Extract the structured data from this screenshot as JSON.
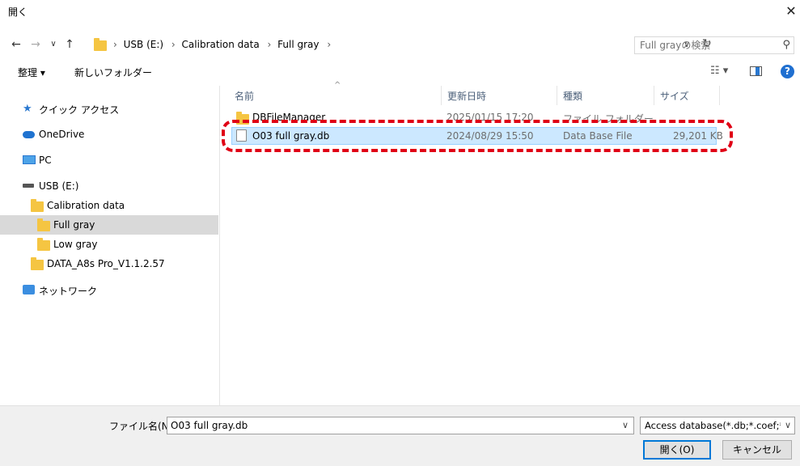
{
  "window": {
    "title": "開く"
  },
  "address": {
    "crumbs": [
      "USB (E:)",
      "Calibration data",
      "Full gray"
    ],
    "separator": "›",
    "search_placeholder": "Full grayの検索"
  },
  "toolbar": {
    "organize": "整理 ▾",
    "new_folder": "新しいフォルダー"
  },
  "nav": {
    "quick_access": "クイック アクセス",
    "onedrive": "OneDrive",
    "pc": "PC",
    "usb": "USB (E:)",
    "calibration": "Calibration data",
    "full_gray": "Full gray",
    "low_gray": "Low gray",
    "data_folder": "DATA_A8s Pro_V1.1.2.57",
    "network": "ネットワーク"
  },
  "columns": {
    "name": "名前",
    "date": "更新日時",
    "type": "種類",
    "size": "サイズ"
  },
  "files": [
    {
      "name": "DBFileManager",
      "date": "2025/01/15 17:20",
      "type": "ファイル フォルダー",
      "size": ""
    },
    {
      "name": "O03 full gray.db",
      "date": "2024/08/29 15:50",
      "type": "Data Base File",
      "size": "29,201 KB"
    }
  ],
  "bottom": {
    "filename_label": "ファイル名(N):",
    "filename_value": "O03 full gray.db",
    "filetype": "Access database(*.db;*.coef;*.sd",
    "open_label": "開く(O)",
    "cancel_label": "キャンセル"
  },
  "colors": {
    "selection": "#cce8ff",
    "accent": "#0078d7",
    "highlight": "#e00015"
  },
  "icons": [
    "close-icon",
    "back-icon",
    "forward-icon",
    "up-icon",
    "refresh-icon",
    "search-icon",
    "view-icon",
    "pane-icon",
    "help-icon"
  ]
}
